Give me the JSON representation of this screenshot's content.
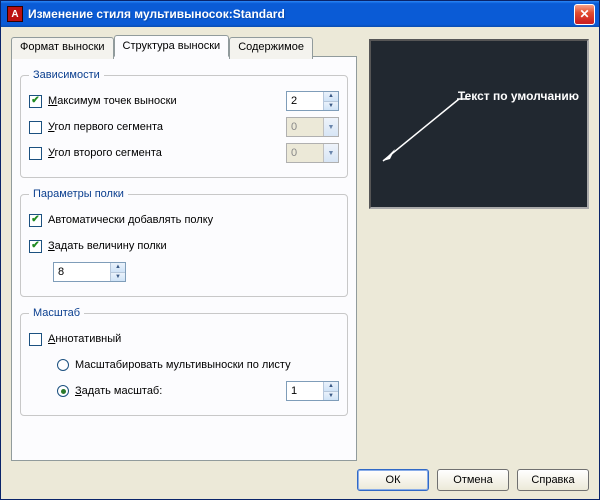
{
  "window": {
    "title": "Изменение стиля мультивыносок:Standard",
    "app_icon_letter": "A"
  },
  "tabs": {
    "items": [
      {
        "label": "Формат выноски"
      },
      {
        "label": "Структура выноски"
      },
      {
        "label": "Содержимое"
      }
    ],
    "active_index": 1
  },
  "groups": {
    "constraints": {
      "legend": "Зависимости",
      "max_points": {
        "prefix": "М",
        "label": "аксимум точек выноски",
        "checked": true,
        "value": "2"
      },
      "first_seg": {
        "prefix": "У",
        "label": "гол первого сегмента",
        "checked": false,
        "value": "0"
      },
      "second_seg": {
        "prefix": "У",
        "label": "гол второго сегмента",
        "checked": false,
        "value": "0"
      }
    },
    "landing": {
      "legend": "Параметры полки",
      "auto_landing": {
        "label": "Автоматически добавлять полку",
        "checked": true
      },
      "set_length": {
        "prefix": "З",
        "label": "адать величину полки",
        "checked": true,
        "value": "8"
      }
    },
    "scale": {
      "legend": "Масштаб",
      "annotative": {
        "prefix": "А",
        "label": "ннотативный",
        "checked": false
      },
      "radio_paper": {
        "label": "Масштабировать мультивыноски по листу",
        "selected": false
      },
      "radio_set": {
        "prefix": "З",
        "label": "адать масштаб:",
        "selected": true,
        "value": "1"
      }
    }
  },
  "preview": {
    "text": "Текст по умолчанию"
  },
  "buttons": {
    "ok": "ОК",
    "cancel": "Отмена",
    "help": "Справка"
  }
}
